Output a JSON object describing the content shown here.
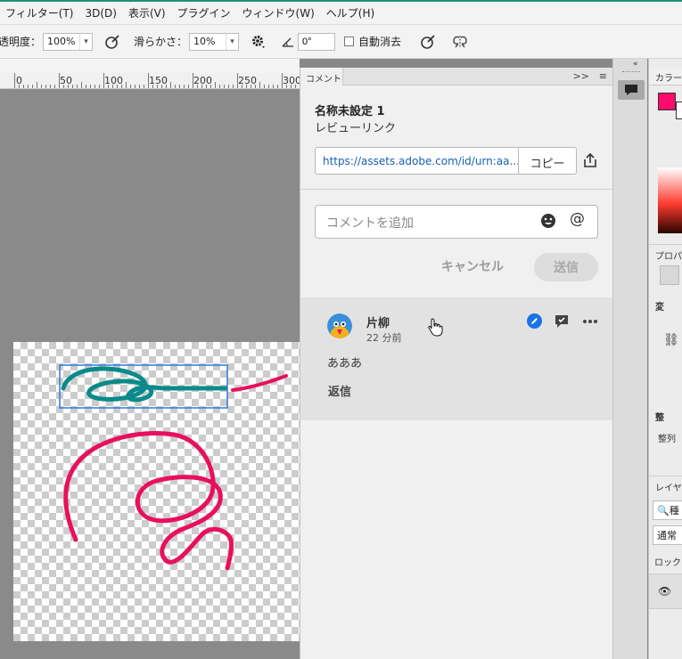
{
  "menubar": {
    "items": [
      "フィルター(T)",
      "3D(D)",
      "表示(V)",
      "プラグイン",
      "ウィンドウ(W)",
      "ヘルプ(H)"
    ]
  },
  "options": {
    "opacity_label": "透明度：",
    "opacity_value": "100%",
    "smoothing_label": "滑らかさ：",
    "smoothing_value": "10%",
    "angle_value": "0°",
    "auto_erase_label": "自動消去",
    "icons": [
      "brush-pressure-icon",
      "gear-icon",
      "angle-icon",
      "pressure-size-icon",
      "symmetry-icon"
    ]
  },
  "ruler": {
    "labels": [
      "0",
      "50",
      "100",
      "150",
      "200",
      "250",
      "300"
    ]
  },
  "comments_panel": {
    "tab_label": "コメント",
    "document_title": "名称未設定 1",
    "subtitle": "レビューリンク",
    "link_url": "https://assets.adobe.com/id/urn:aa...",
    "copy_label": "コピー",
    "input_placeholder": "コメントを追加",
    "cancel_label": "キャンセル",
    "send_label": "送信",
    "thread": {
      "author": "片柳",
      "time": "22 分前",
      "text": "あああ",
      "reply_label": "返信"
    }
  },
  "right_panels": {
    "color_tab": "カラー",
    "properties_tab": "プロパテ",
    "transform_section": "変",
    "align_section": "整",
    "align_label": "整列",
    "layers_tab": "レイヤー",
    "layer_search": "種",
    "blend_mode": "通常",
    "lock_label": "ロック："
  },
  "colors": {
    "foreground": "#ff0b6b",
    "accent_teal": "#1f8f7b",
    "stroke_teal": "#0a8a8a",
    "stroke_pink": "#e8105e",
    "link_blue": "#1a5fb4"
  }
}
